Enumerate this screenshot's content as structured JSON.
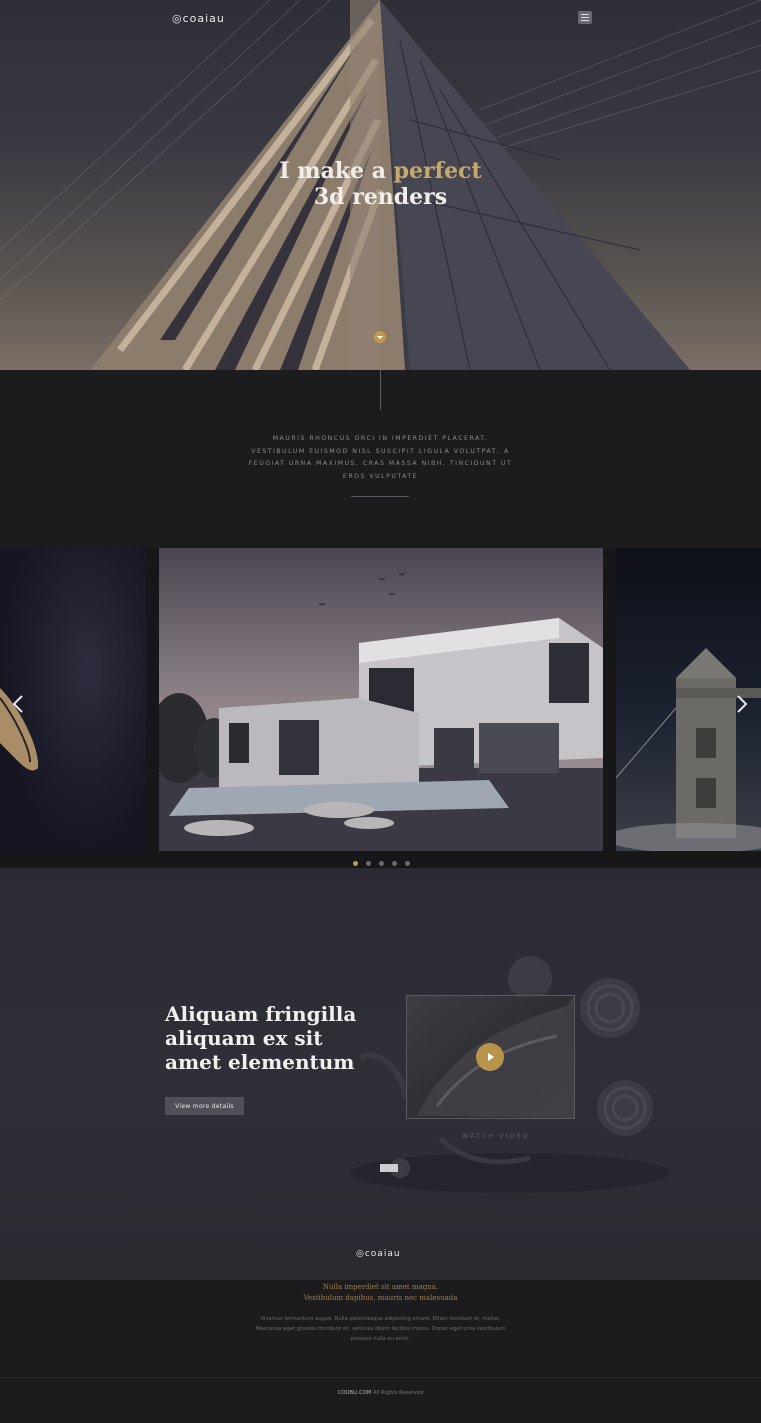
{
  "header": {
    "logo": "◎coaiau",
    "menu_icon": "hamburger-icon"
  },
  "hero": {
    "title_line1_pre": "I make a ",
    "title_accent": "perfect",
    "title_line2": "3d renders",
    "accent_color": "#c8a96c"
  },
  "intro": {
    "text": "Mauris rhoncus orci in imperdiet placerat. Vestibulum euismod nisl suscipit ligula volutpat, a feugiat urna maximus. Cras massa nibh, tincidunt ut eros vulputate"
  },
  "slider": {
    "prev_icon": "chevron-left-icon",
    "next_icon": "chevron-right-icon",
    "dots": 5,
    "active_dot": 0
  },
  "feature": {
    "title": "Aliquam fringilla aliquam ex sit amet elementum",
    "button_label": "View more details",
    "watch_label": "Watch video",
    "play_icon": "play-icon",
    "logo": "◎coaiau"
  },
  "footer": {
    "quote_line1": "Nulla imperdiet sit amet magna.",
    "quote_line2": "Vestibulum dapibus, mauris nec malesuada",
    "text": "Vivamus fermentum augue. Nulla pellentesque adipiscing ornare. Etiam tincidunt et, metus. Maecenas eget gravida tincidunt sit, vehicula libero facilisis metus. Donec eget urna vestibulum posuere nulla eu enim.",
    "copyright_brand": "COOBLI.COM",
    "copyright_rest": " All Rights Reserved"
  },
  "colors": {
    "accent": "#c29a4d",
    "background": "#1c1c1e"
  }
}
